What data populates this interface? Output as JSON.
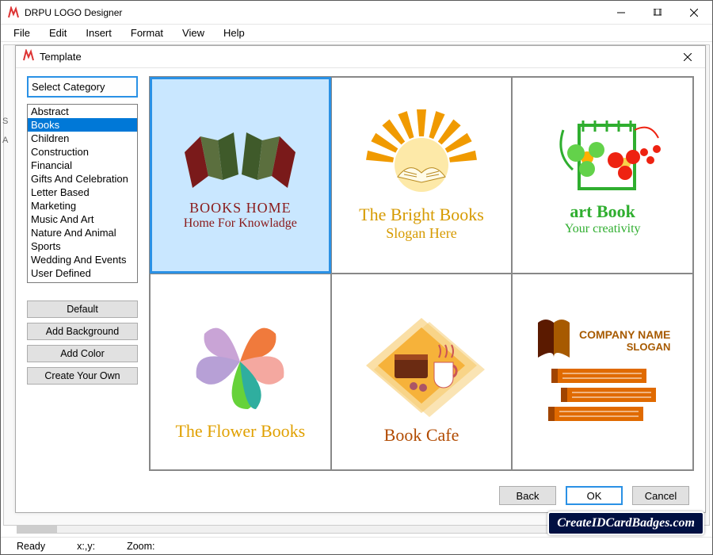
{
  "app": {
    "title": "DRPU LOGO Designer"
  },
  "menu": {
    "file": "File",
    "edit": "Edit",
    "insert": "Insert",
    "format": "Format",
    "view": "View",
    "help": "Help"
  },
  "dialog": {
    "title": "Template",
    "select_category": "Select Category",
    "categories": [
      "Abstract",
      "Books",
      "Children",
      "Construction",
      "Financial",
      "Gifts And Celebration",
      "Letter Based",
      "Marketing",
      "Music And Art",
      "Nature And Animal",
      "Sports",
      "Wedding And Events",
      "User Defined"
    ],
    "selected_category_index": 1,
    "buttons": {
      "default": "Default",
      "add_background": "Add Background",
      "add_color": "Add Color",
      "create_own": "Create Your Own"
    },
    "footer": {
      "back": "Back",
      "ok": "OK",
      "cancel": "Cancel"
    }
  },
  "templates": [
    {
      "title": "BOOKS HOME",
      "subtitle": "Home For Knowladge",
      "title_color": "#8a1a1a",
      "subtitle_color": "#8a1a1a"
    },
    {
      "title": "The Bright Books",
      "subtitle": "Slogan Here",
      "title_color": "#d69a00",
      "subtitle_color": "#d69a00"
    },
    {
      "title": "art Book",
      "subtitle": "Your creativity",
      "title_color": "#2fae2f",
      "subtitle_color": "#2fae2f"
    },
    {
      "title": "The Flower Books",
      "subtitle": "",
      "title_color": "#e0a000",
      "subtitle_color": "#e0a000"
    },
    {
      "title": "Book Cafe",
      "subtitle": "",
      "title_color": "#b14a00",
      "subtitle_color": "#b14a00"
    },
    {
      "title": "COMPANY NAME",
      "subtitle": "SLOGAN",
      "title_color": "#a75a00",
      "subtitle_color": "#a75a00"
    }
  ],
  "status": {
    "ready": "Ready",
    "xy": "x:,y:",
    "zoom": "Zoom:"
  },
  "badge": "CreateIDCardBadges.com"
}
